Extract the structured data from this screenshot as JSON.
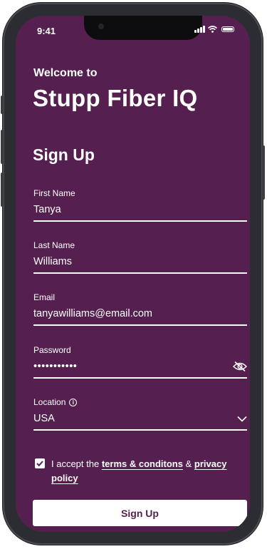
{
  "status_bar": {
    "time": "9:41"
  },
  "header": {
    "welcome": "Welcome to",
    "app_name": "Stupp Fiber IQ"
  },
  "form": {
    "title": "Sign Up",
    "fields": [
      {
        "label": "First Name",
        "value": "Tanya"
      },
      {
        "label": "Last Name",
        "value": "Williams"
      },
      {
        "label": "Email",
        "value": "tanyawilliams@email.com"
      },
      {
        "label": "Password",
        "value": "•••••••••••",
        "icon": "eye-slash-icon"
      },
      {
        "label": "Location",
        "value": "USA",
        "icon": "chevron-down-icon",
        "info_icon": "info-icon"
      }
    ],
    "consent": {
      "checked": true,
      "text_before": "I accept the",
      "terms_link": "terms & conditons",
      "connector": "&",
      "privacy_link": "privacy policy"
    },
    "submit_label": "Sign Up"
  },
  "colors": {
    "background": "#55204f",
    "accent_text": "#ffffff",
    "button_text": "#55204f"
  }
}
